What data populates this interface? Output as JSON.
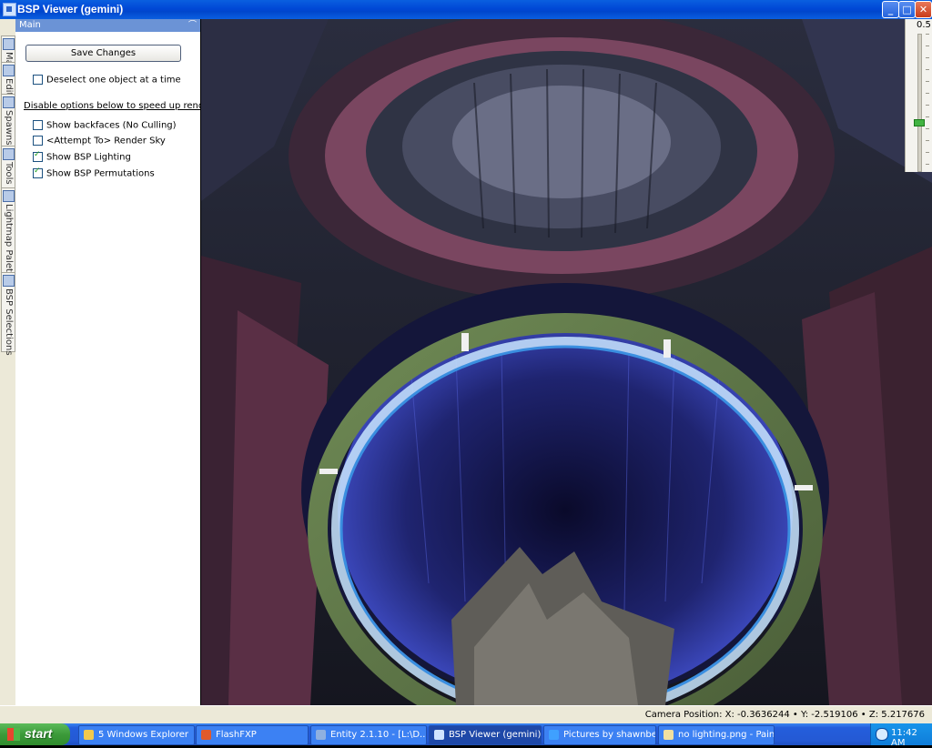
{
  "window": {
    "title": "BSP Viewer (gemini)",
    "min_label": "_",
    "max_label": "□",
    "close_label": "✕"
  },
  "tabs": [
    {
      "label": "Main"
    },
    {
      "label": "Edit"
    },
    {
      "label": "Spawns"
    },
    {
      "label": "Tools"
    },
    {
      "label": "Lightmap Palettes"
    },
    {
      "label": "BSP Selections"
    }
  ],
  "panel": {
    "header": "Main",
    "pin": "⌒",
    "save_label": "Save Changes",
    "deselect_label": "Deselect one object at a time",
    "deselect_checked": false,
    "disable_label": "Disable options below to speed up rendering",
    "options": [
      {
        "label": "Show backfaces (No Culling)",
        "checked": false
      },
      {
        "label": "<Attempt To> Render Sky",
        "checked": false
      },
      {
        "label": "Show BSP Lighting",
        "checked": true
      },
      {
        "label": "Show BSP Permutations",
        "checked": true
      }
    ]
  },
  "slider": {
    "value_label": "0.5",
    "value": 0.5
  },
  "status": {
    "camera": "Camera Position: X: -0.3636244 • Y: -2.519106 • Z: 5.217676"
  },
  "taskbar": {
    "start": "start",
    "items": [
      {
        "label": "5 Windows Explorer",
        "icon": "folder-icon",
        "color": "#f2c94c"
      },
      {
        "label": "FlashFXP",
        "icon": "flashfxp-icon",
        "color": "#e05a2b"
      },
      {
        "label": "Entity  2.1.10 - [L:\\D...",
        "icon": "entity-icon",
        "color": "#8fb0e0"
      },
      {
        "label": "BSP Viewer (gemini)",
        "icon": "bspviewer-icon",
        "color": "#cfe3ff"
      },
      {
        "label": "Pictures by shawnbec...",
        "icon": "ie-icon",
        "color": "#3fa0ff"
      },
      {
        "label": "no lighting.png - Pain...",
        "icon": "paint-icon",
        "color": "#f0e0a0"
      }
    ],
    "clock": "11:42 AM"
  }
}
